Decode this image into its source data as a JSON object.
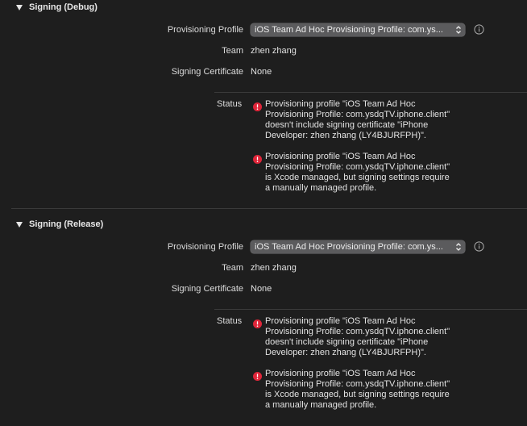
{
  "sections": [
    {
      "title": "Signing (Debug)",
      "provisioning_profile_label": "Provisioning Profile",
      "provisioning_profile_value": "iOS Team Ad Hoc Provisioning Profile: com.ys...",
      "team_label": "Team",
      "team_value": "zhen zhang",
      "certificate_label": "Signing Certificate",
      "certificate_value": "None",
      "status_label": "Status",
      "issues": [
        "Provisioning profile \"iOS Team Ad Hoc\nProvisioning Profile: com.ysdqTV.iphone.client\"\ndoesn't include signing certificate \"iPhone\nDeveloper: zhen zhang (LY4BJURFPH)\".",
        "Provisioning profile \"iOS Team Ad Hoc\nProvisioning Profile: com.ysdqTV.iphone.client\"\nis Xcode managed, but signing settings require\na manually managed profile."
      ]
    },
    {
      "title": "Signing (Release)",
      "provisioning_profile_label": "Provisioning Profile",
      "provisioning_profile_value": "iOS Team Ad Hoc Provisioning Profile: com.ys...",
      "team_label": "Team",
      "team_value": "zhen zhang",
      "certificate_label": "Signing Certificate",
      "certificate_value": "None",
      "status_label": "Status",
      "issues": [
        "Provisioning profile \"iOS Team Ad Hoc\nProvisioning Profile: com.ysdqTV.iphone.client\"\ndoesn't include signing certificate \"iPhone\nDeveloper: zhen zhang (LY4BJURFPH)\".",
        "Provisioning profile \"iOS Team Ad Hoc\nProvisioning Profile: com.ysdqTV.iphone.client\"\nis Xcode managed, but signing settings require\na manually managed profile."
      ]
    }
  ],
  "icons": {
    "disclosure": "disclosure-triangle-down-icon",
    "popup": "popup-arrows-icon",
    "info": "info-circle-icon",
    "error": "error-exclamation-icon"
  },
  "colors": {
    "background": "#1e1e1e",
    "popup": "#5b5b5d",
    "error": "#e0263a",
    "divider": "#3a3a3a"
  }
}
